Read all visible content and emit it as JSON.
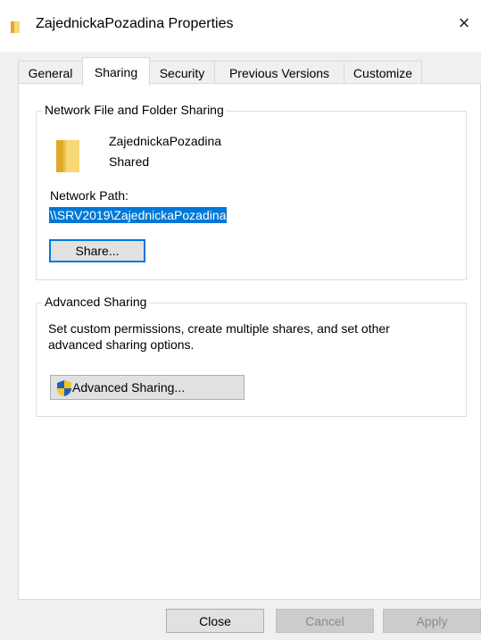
{
  "window": {
    "title": "ZajednickaPozadina Properties",
    "close_glyph": "×"
  },
  "tabs": [
    {
      "label": "General"
    },
    {
      "label": "Sharing"
    },
    {
      "label": "Security"
    },
    {
      "label": "Previous Versions"
    },
    {
      "label": "Customize"
    }
  ],
  "active_tab": "Sharing",
  "network_sharing": {
    "group_title": "Network File and Folder Sharing",
    "folder_name": "ZajednickaPozadina",
    "folder_status": "Shared",
    "path_label": "Network Path:",
    "path_value": "\\\\SRV2019\\ZajednickaPozadina",
    "share_button": "Share..."
  },
  "advanced_sharing": {
    "group_title": "Advanced Sharing",
    "description_line1": "Set custom permissions, create multiple shares, and set other",
    "description_line2": "advanced sharing options.",
    "button_label": "Advanced Sharing..."
  },
  "footer": {
    "close": "Close",
    "cancel": "Cancel",
    "apply": "Apply"
  },
  "colors": {
    "accent": "#0078d7",
    "folder": "#f8d775"
  },
  "icons": {
    "title": "folder-icon",
    "large": "folder-icon",
    "advanced": "uac-shield-icon"
  }
}
